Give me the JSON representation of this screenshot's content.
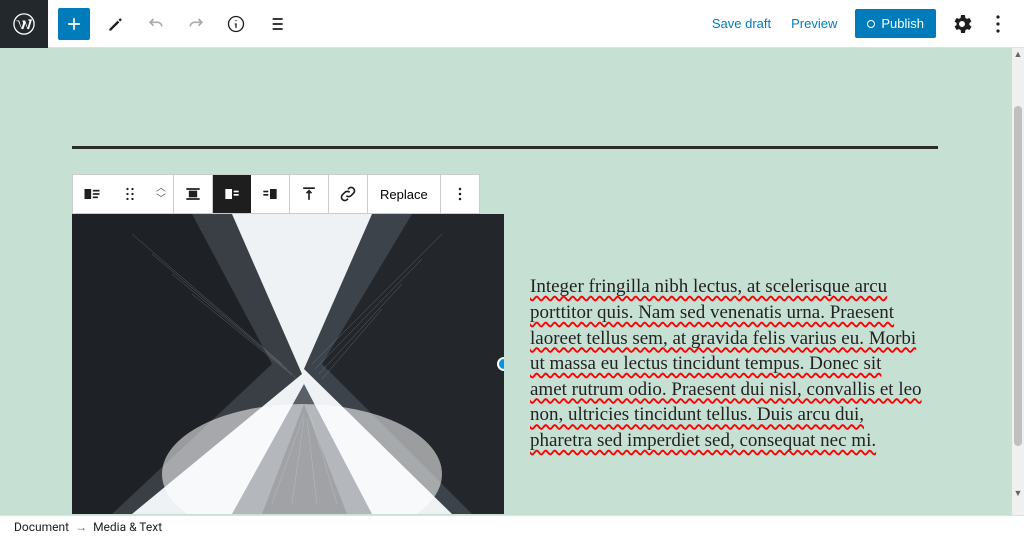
{
  "topbar": {
    "save_draft": "Save draft",
    "preview": "Preview",
    "publish": "Publish"
  },
  "block_toolbar": {
    "replace": "Replace"
  },
  "content": {
    "paragraph": "Integer fringilla nibh lectus, at scelerisque arcu porttitor quis. Nam sed venenatis urna. Praesent laoreet tellus sem, at gravida felis varius eu. Morbi ut massa eu lectus tincidunt tempus. Donec sit amet rutrum odio. Praesent dui nisl, convallis et leo non, ultricies tincidunt tellus. Duis arcu dui, pharetra sed imperdiet sed, consequat nec mi."
  },
  "breadcrumb": {
    "root": "Document",
    "current": "Media & Text"
  }
}
